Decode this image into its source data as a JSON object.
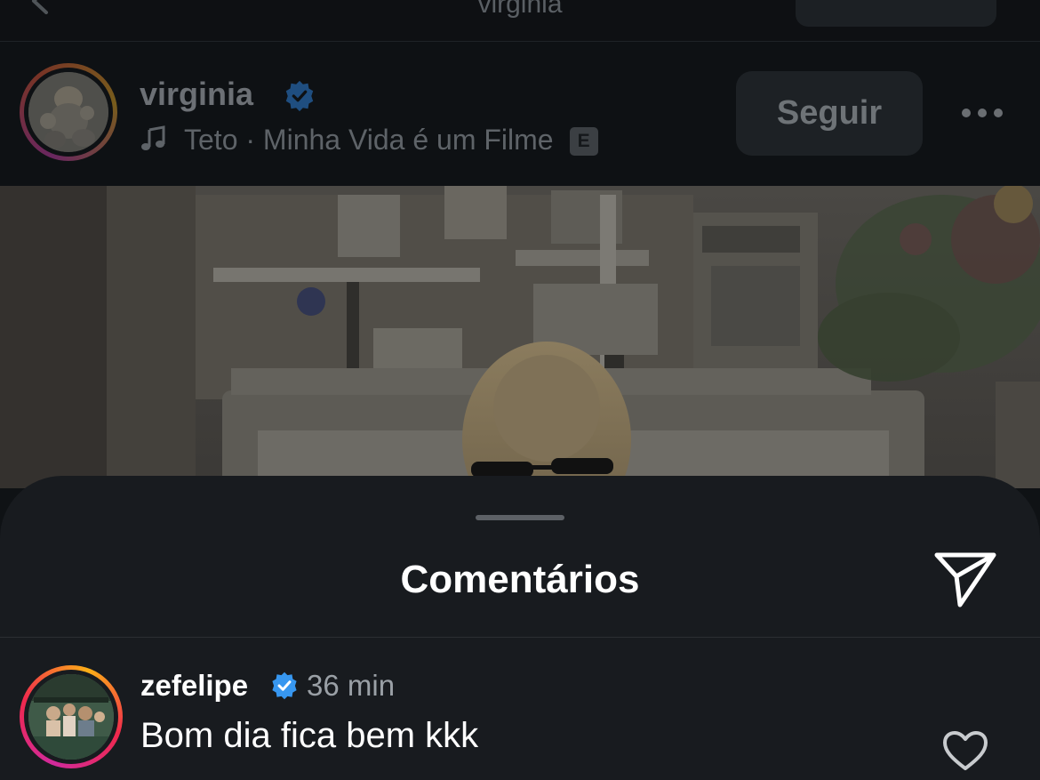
{
  "top_bar": {
    "title": "virginia"
  },
  "post": {
    "username": "virginia",
    "verified": true,
    "music": {
      "artist": "Teto",
      "separator": " · ",
      "song": "Minha Vida é um Filme",
      "explicit_label": "E"
    },
    "follow_label": "Seguir"
  },
  "comments_sheet": {
    "title": "Comentários",
    "comments": [
      {
        "username": "zefelipe",
        "verified": true,
        "time": "36 min",
        "text": "Bom dia fica bem kkk"
      }
    ]
  },
  "colors": {
    "verified_blue": "#3797f0",
    "sheet_background": "#181b1f",
    "story_ring": [
      "#d12a9c",
      "#f0294d",
      "#fcaf17"
    ]
  },
  "icons": {
    "back": "chevron-left-icon",
    "verified": "verified-badge-icon",
    "music": "music-note-icon",
    "more": "more-horizontal-icon",
    "share": "paper-plane-icon",
    "like": "heart-outline-icon"
  }
}
